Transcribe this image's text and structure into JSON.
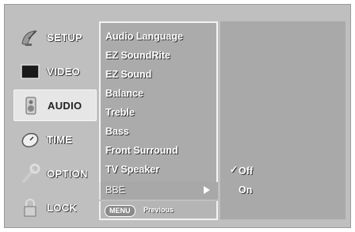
{
  "sidebar": {
    "items": [
      {
        "label": "SETUP",
        "icon": "satellite-dish-icon"
      },
      {
        "label": "VIDEO",
        "icon": "tv-screen-icon"
      },
      {
        "label": "AUDIO",
        "icon": "speaker-icon",
        "selected": true
      },
      {
        "label": "TIME",
        "icon": "clock-icon"
      },
      {
        "label": "OPTION",
        "icon": "wrench-icon"
      },
      {
        "label": "LOCK",
        "icon": "padlock-icon"
      }
    ]
  },
  "audio_menu": {
    "items": [
      "Audio Language",
      "EZ SoundRite",
      "EZ Sound",
      "Balance",
      "Treble",
      "Bass",
      "Front Surround",
      "TV Speaker"
    ],
    "submenu_row": {
      "label": "BBE",
      "arrow": "right-arrow-icon"
    },
    "footer": {
      "menu_button": "MENU",
      "previous_label": "Previous"
    }
  },
  "options": {
    "checkmark": "✓",
    "items": [
      "Off",
      "On"
    ],
    "selected": "Off"
  },
  "colors": {
    "frame": "#bfbfbf",
    "panel": "#ababab",
    "text": "#ffffff"
  }
}
